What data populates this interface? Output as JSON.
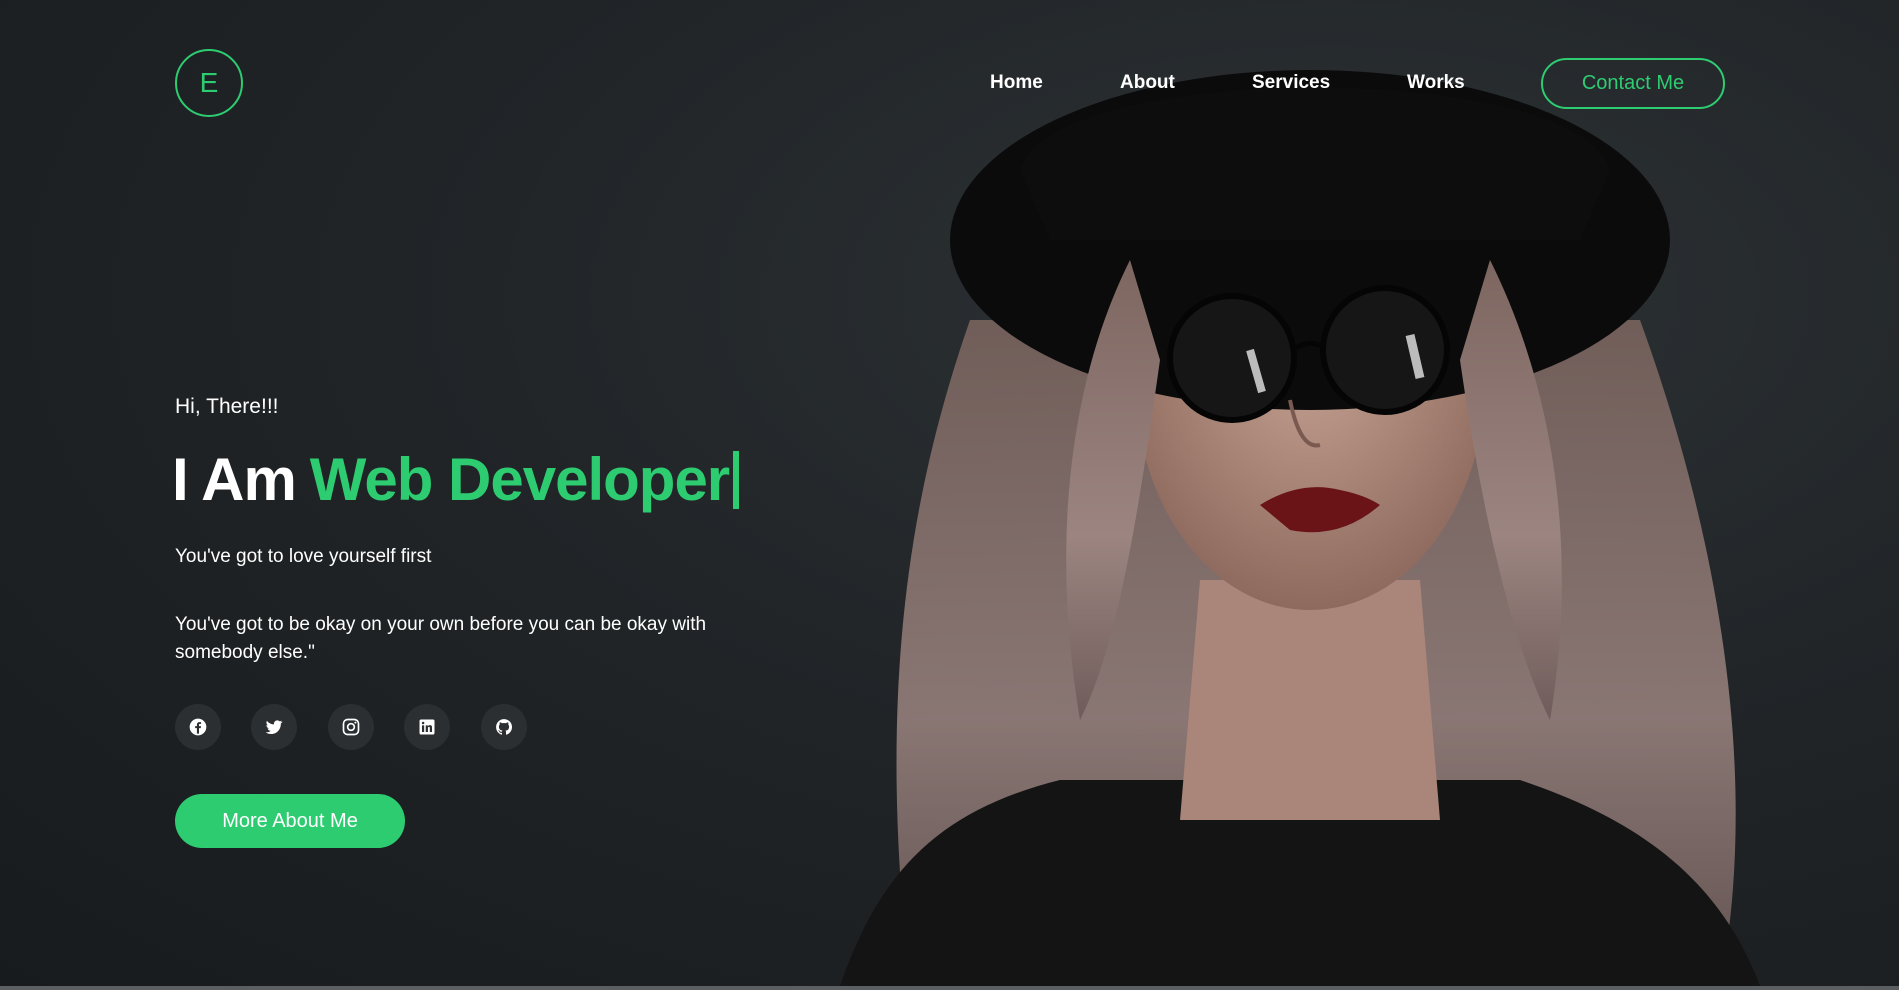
{
  "header": {
    "logo_letter": "E",
    "nav": [
      {
        "label": "Home"
      },
      {
        "label": "About"
      },
      {
        "label": "Services"
      },
      {
        "label": "Works"
      }
    ],
    "contact_label": "Contact Me"
  },
  "hero": {
    "greeting": "Hi, There!!!",
    "headline_prefix": "I Am",
    "headline_accent": "Web Developer",
    "quote_line1": "You've got to love yourself first",
    "quote_line2": "You've got to be okay on your own before you can be okay with somebody else.\"",
    "socials": [
      {
        "icon": "facebook-icon"
      },
      {
        "icon": "twitter-icon"
      },
      {
        "icon": "instagram-icon"
      },
      {
        "icon": "linkedin-icon"
      },
      {
        "icon": "github-icon"
      }
    ],
    "cta_label": "More About Me"
  },
  "colors": {
    "accent": "#2ecc71",
    "background": "#1e2124"
  }
}
